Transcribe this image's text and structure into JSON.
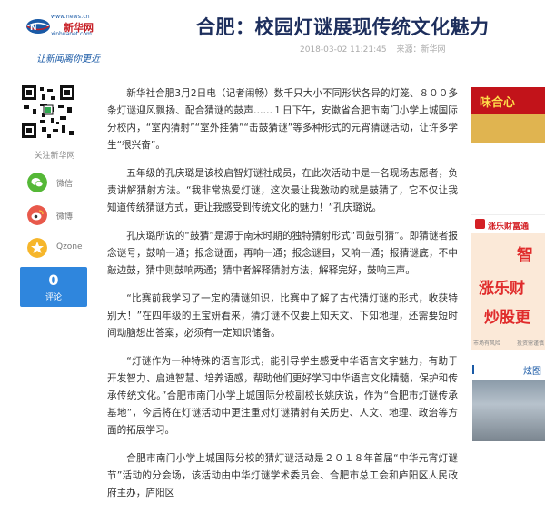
{
  "header": {
    "logo_url": "www.news.cn",
    "logo_cn": "新华网",
    "logo_en": "xinhuanet.com",
    "logo_slogan": "让新闻离你更近",
    "title": "合肥：校园灯谜展现传统文化魅力",
    "date": "2018-03-02 11:21:45",
    "source": "来源：新华网"
  },
  "share": {
    "follow_label": "关注新华网",
    "wechat_label": "微信",
    "weibo_label": "微博",
    "qzone_label": "Qzone",
    "comment_count": "0",
    "comment_label": "评论"
  },
  "article": {
    "paragraphs": [
      "新华社合肥3月2日电（记者闹畅）数千只大小不同形状各异的灯笼、８００多条灯谜迎风飘扬、配合猜谜的鼓声……１日下午，安徽省合肥市南门小学上城国际分校内，“室内猜射”“室外挂猜”“击鼓猜谜”等多种形式的元宵猜谜活动，让许多学生“很兴奋”。",
      "五年级的孔庆璐是该校启智灯谜社成员，在此次活动中是一名现场志愿者，负责讲解猜射方法。“我非常热爱灯谜，这次最让我激动的就是鼓猜了，它不仅让我知道传统猜谜方式，更让我感受到传统文化的魅力！”孔庆璐说。",
      "孔庆璐所说的“鼓猜”是源于南宋时期的独特猜射形式“司鼓引猜”。即猜谜者报念谜号，鼓响一通；报念谜面，再响一通；报念谜目，又响一通；报猜谜底，不中敲边鼓，猜中则鼓响两通；猜中者解释猜射方法，解释完好，鼓响三声。",
      "“比赛前我学习了一定的猜谜知识，比赛中了解了古代猜灯谜的形式，收获特别大！”在四年级的王宝妍看来，猜灯谜不仅要上知天文、下知地理，还需要短时间动脑想出答案，必须有一定知识储备。",
      "“灯谜作为一种特殊的语言形式，能引导学生感受中华语言文字魅力，有助于开发智力、启迪智慧、培养语感，帮助他们更好学习中华语言文化精髓，保护和传承传统文化。”合肥市南门小学上城国际分校副校长姚庆说，作为“合肥市灯谜传承基地”，今后将在灯谜活动中更注重对灯谜猜射有关历史、人文、地理、政治等方面的拓展学习。",
      "合肥市南门小学上城国际分校的猜灯谜活动是２０１８年首届“中华元宵灯谜节”活动的分会场，该活动由中华灯谜学术委员会、合肥市总工会和庐阳区人民政府主办，庐阳区"
    ]
  },
  "ads": {
    "ad1_text": "味合心",
    "ad2_brand": "涨乐财富通",
    "ad2_big1": "智",
    "ad2_big2": "涨乐财",
    "ad2_big3": "炒股更",
    "ad2_foot1": "市场有风险",
    "ad2_foot2": "投资需谨慎"
  },
  "photo": {
    "label": "炫图"
  }
}
